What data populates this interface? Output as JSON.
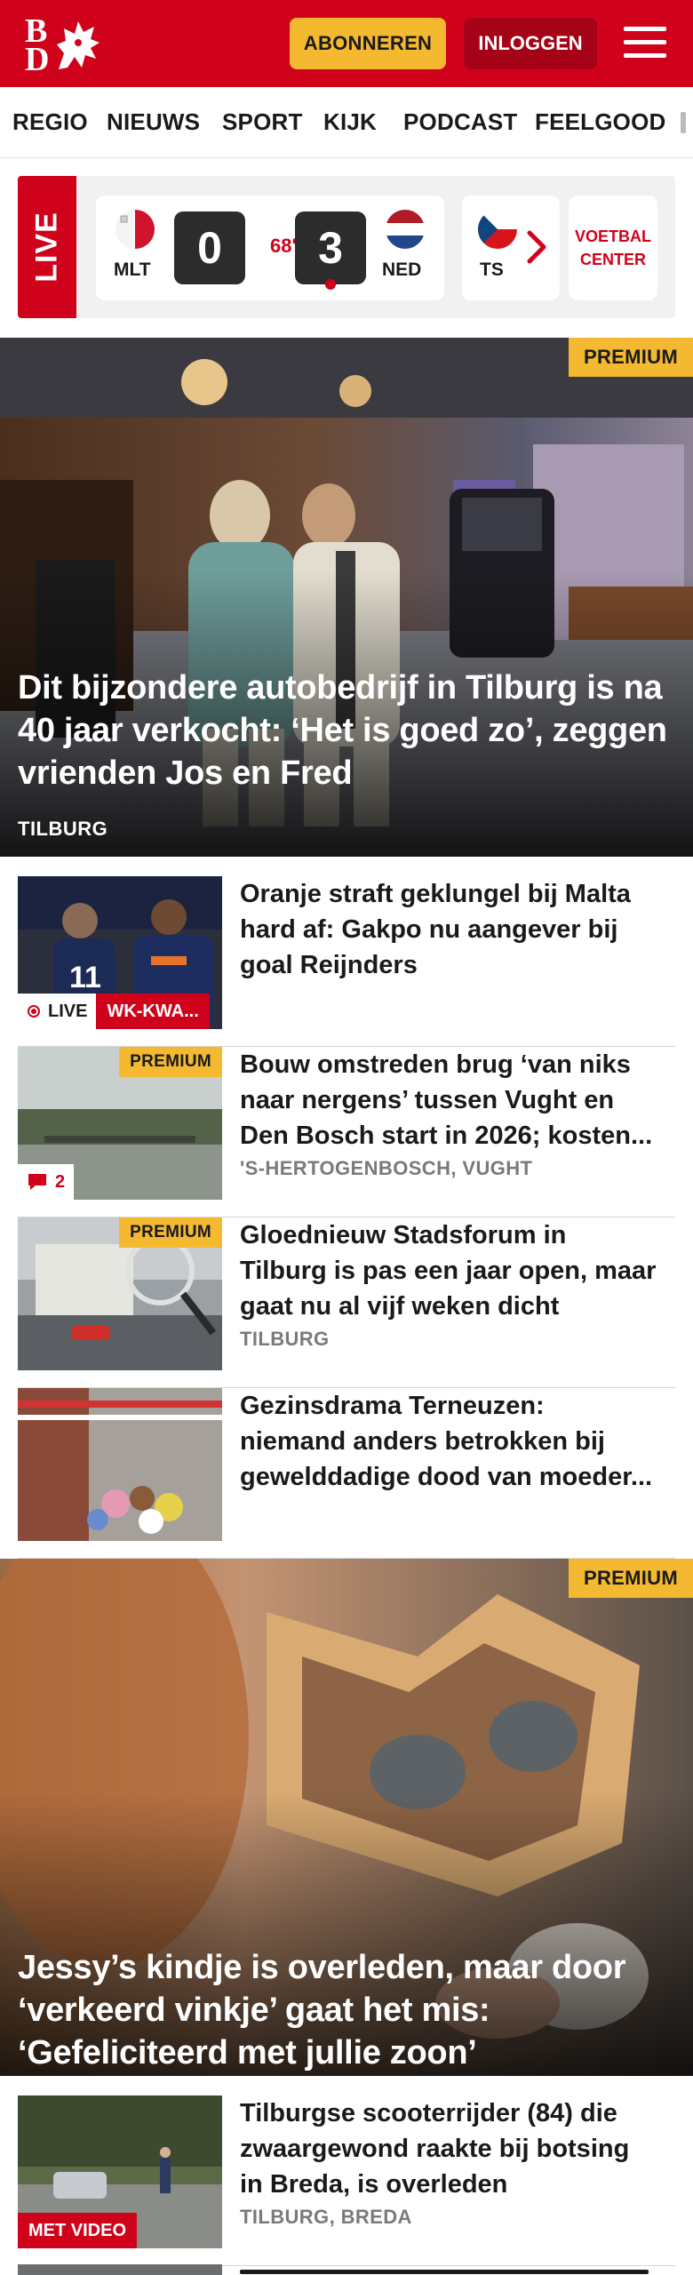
{
  "header": {
    "logo_b": "B",
    "logo_d": "D",
    "subscribe_label": "ABONNEREN",
    "login_label": "INLOGGEN",
    "brand_color": "#d0021b"
  },
  "nav": {
    "items": [
      "REGIO",
      "NIEUWS",
      "SPORT",
      "KIJK",
      "PODCAST",
      "FEELGOOD"
    ]
  },
  "live_strip": {
    "live_label": "LIVE",
    "match": {
      "home_code": "MLT",
      "home_score": "0",
      "minute": "68'",
      "away_score": "3",
      "away_code": "NED"
    },
    "next_match_code": "TS",
    "voetbal_center_line1": "VOETBAL",
    "voetbal_center_line2": "CENTER"
  },
  "hero1": {
    "badge": "PREMIUM",
    "title": "Dit bijzondere autobedrijf in Tilburg is na 40 jaar verkocht: ‘Het is goed zo’, zeggen vrienden Jos en Fred",
    "location": "TILBURG"
  },
  "articles": [
    {
      "title": "Oranje straft geklungel bij Malta hard af: Gakpo nu aangever bij goal Reijnders",
      "live_label": "LIVE",
      "category": "WK-KWA..."
    },
    {
      "badge": "PREMIUM",
      "title": "Bouw omstreden brug ‘van niks naar nergens’ tussen Vught en Den Bosch start in 2026; kosten...",
      "location": "'S-HERTOGENBOSCH, VUGHT",
      "comments": "2"
    },
    {
      "badge": "PREMIUM",
      "title": "Gloednieuw Stadsforum in Tilburg is pas een jaar open, maar gaat nu al vijf weken dicht",
      "location": "TILBURG"
    },
    {
      "title": "Gezinsdrama Terneuzen: niemand anders betrokken bij gewelddadige dood van moeder..."
    }
  ],
  "hero2": {
    "badge": "PREMIUM",
    "title": "Jessy’s kindje is overleden, maar door ‘verkeerd vinkje’ gaat het mis: ‘Gefeliciteerd met jullie zoon’"
  },
  "articles2": [
    {
      "title": "Tilburgse scooterrijder (84) die zwaargewond raakte bij botsing in Breda, is overleden",
      "location": "TILBURG, BREDA",
      "video_label": "MET VIDEO"
    }
  ]
}
